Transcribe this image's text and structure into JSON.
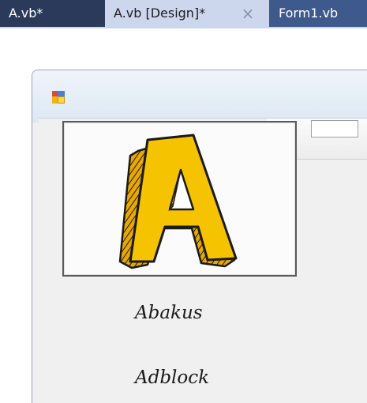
{
  "tabs": [
    {
      "label": "A.vb*",
      "active": false
    },
    {
      "label": "A.vb [Design]*",
      "active": true
    },
    {
      "label": "Form1.vb",
      "active": false
    }
  ],
  "tab_close_glyph": "×",
  "form": {
    "icon": "form-app-icon",
    "picture_icon": "letter-a-logo",
    "items": [
      "Abakus",
      "Adblock"
    ]
  },
  "colors": {
    "tabstrip": "#2b3a5a",
    "active_tab": "#ccd6ec",
    "form1_tab": "#3e5a8c",
    "logo_fill": "#f5c300",
    "logo_outline": "#1a1a1a"
  }
}
